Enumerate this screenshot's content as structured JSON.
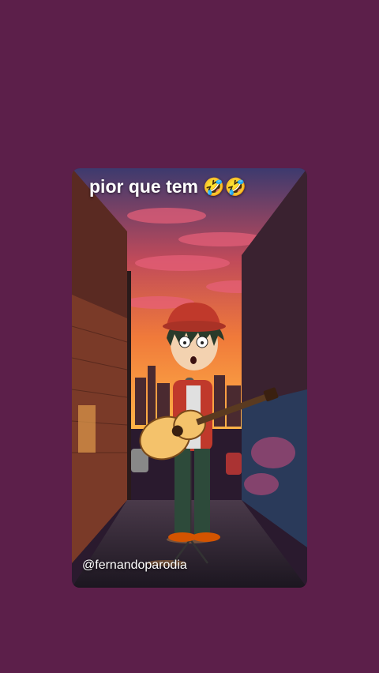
{
  "background_color": "#5c1f4a",
  "video": {
    "caption_text": "pior que tem",
    "caption_emojis": "🤣🤣",
    "watermark": "@fernandoparodia",
    "image_description_icon": "cartoon-guitarist-illustration"
  }
}
